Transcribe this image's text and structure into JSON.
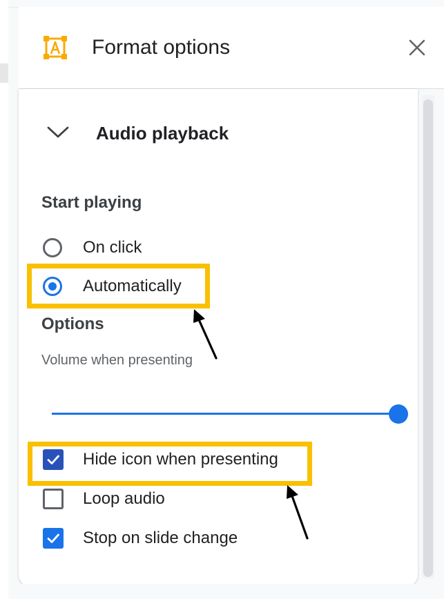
{
  "panel": {
    "title": "Format options",
    "header_icon": "format-text-box-icon",
    "close_icon": "close-icon",
    "accent_color": "#f9ab00"
  },
  "section": {
    "title": "Audio playback",
    "expanded": true,
    "chevron_icon": "chevron-down-icon"
  },
  "start_playing": {
    "label": "Start playing",
    "options": [
      {
        "label": "On click",
        "selected": false
      },
      {
        "label": "Automatically",
        "selected": true
      }
    ]
  },
  "options": {
    "label": "Options",
    "volume_label": "Volume when presenting",
    "volume_level": 1.0,
    "checkboxes": [
      {
        "label": "Hide icon when presenting",
        "checked": true
      },
      {
        "label": "Loop audio",
        "checked": false
      },
      {
        "label": "Stop on slide change",
        "checked": true
      }
    ]
  },
  "colors": {
    "primary": "#1a73e8",
    "highlight": "#f9c000",
    "text": "#202124"
  }
}
